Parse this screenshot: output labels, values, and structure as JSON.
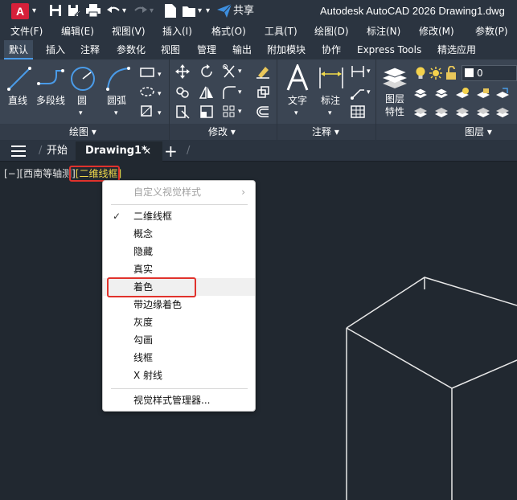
{
  "app": {
    "logo": "A",
    "title": "Autodesk AutoCAD 2026   Drawing1.dwg",
    "share": "共享"
  },
  "menu": [
    "文件(F)",
    "编辑(E)",
    "视图(V)",
    "插入(I)",
    "格式(O)",
    "工具(T)",
    "绘图(D)",
    "标注(N)",
    "修改(M)",
    "参数(P)"
  ],
  "ribbon_tabs": [
    "默认",
    "插入",
    "注释",
    "参数化",
    "视图",
    "管理",
    "输出",
    "附加模块",
    "协作",
    "Express Tools",
    "精选应用"
  ],
  "active_ribbon_tab": "默认",
  "ribbon": {
    "draw": {
      "title": "绘图 ▾",
      "tools": [
        "直线",
        "多段线",
        "圆",
        "圆弧"
      ]
    },
    "modify": {
      "title": "修改 ▾"
    },
    "annotate": {
      "title": "注释 ▾",
      "tools": [
        "文字",
        "标注"
      ]
    },
    "layers": {
      "title": "图层 ▾",
      "properties_label_1": "图层",
      "properties_label_2": "特性",
      "current_layer": "0"
    }
  },
  "doc_tabs": {
    "start": "开始",
    "active": "Drawing1*",
    "close": "✕",
    "add": "+"
  },
  "viewport": {
    "prefix": "[−][西南等轴测]",
    "style": "[二维线框]"
  },
  "context_menu": {
    "header": "自定义视觉样式",
    "items": [
      "二维线框",
      "概念",
      "隐藏",
      "真实",
      "着色",
      "带边缘着色",
      "灰度",
      "勾画",
      "线框",
      "X 射线"
    ],
    "checked": "二维线框",
    "hovered": "着色",
    "footer": "视觉样式管理器..."
  },
  "colors": {
    "accent": "#4a9be8",
    "highlight_red": "#e0322c",
    "viewport_style": "#f0d94b",
    "canvas": "#212830"
  }
}
